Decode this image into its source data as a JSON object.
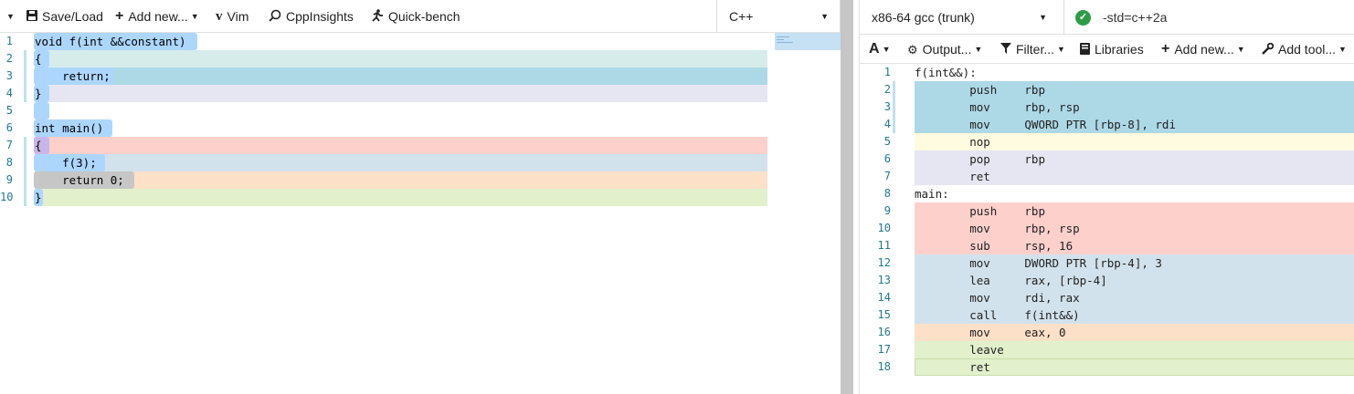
{
  "editor_toolbar": {
    "save_load": "Save/Load",
    "add_new": "Add new...",
    "vim": "Vim",
    "cppinsights": "CppInsights",
    "quick_bench": "Quick-bench",
    "language": "C++"
  },
  "source_lines": [
    {
      "n": "1",
      "text": "void f(int &&constant)"
    },
    {
      "n": "2",
      "text": "{"
    },
    {
      "n": "3",
      "text": "    return;"
    },
    {
      "n": "4",
      "text": "}"
    },
    {
      "n": "5",
      "text": ""
    },
    {
      "n": "6",
      "text": "int main()"
    },
    {
      "n": "7",
      "text": "{"
    },
    {
      "n": "8",
      "text": "    f(3);"
    },
    {
      "n": "9",
      "text": "    return 0;"
    },
    {
      "n": "10",
      "text": "}"
    }
  ],
  "compiler_bar": {
    "compiler": "x86-64 gcc (trunk)",
    "options": "-std=c++2a"
  },
  "output_toolbar": {
    "font": "A",
    "output": "Output...",
    "filter": "Filter...",
    "libraries": "Libraries",
    "add_new": "Add new...",
    "add_tool": "Add tool..."
  },
  "asm_lines": [
    {
      "n": "1",
      "text": "f(int&&):"
    },
    {
      "n": "2",
      "text": "        push    rbp"
    },
    {
      "n": "3",
      "text": "        mov     rbp, rsp"
    },
    {
      "n": "4",
      "text": "        mov     QWORD PTR [rbp-8], rdi"
    },
    {
      "n": "5",
      "text": "        nop"
    },
    {
      "n": "6",
      "text": "        pop     rbp"
    },
    {
      "n": "7",
      "text": "        ret"
    },
    {
      "n": "8",
      "text": "main:"
    },
    {
      "n": "9",
      "text": "        push    rbp"
    },
    {
      "n": "10",
      "text": "        mov     rbp, rsp"
    },
    {
      "n": "11",
      "text": "        sub     rsp, 16"
    },
    {
      "n": "12",
      "text": "        mov     DWORD PTR [rbp-4], 3"
    },
    {
      "n": "13",
      "text": "        lea     rax, [rbp-4]"
    },
    {
      "n": "14",
      "text": "        mov     rdi, rax"
    },
    {
      "n": "15",
      "text": "        call    f(int&&)"
    },
    {
      "n": "16",
      "text": "        mov     eax, 0"
    },
    {
      "n": "17",
      "text": "        leave"
    },
    {
      "n": "18",
      "text": "        ret"
    }
  ],
  "colors": {
    "line_blue": "#add8e6",
    "line_teal": "#d6ecea",
    "line_lavender": "#e6e6f2",
    "line_pink": "#fdd0cc",
    "line_steel": "#d2e2ec",
    "line_peach": "#fde0c8",
    "line_green": "#e2f0cc",
    "line_cream": "#fffbe0",
    "selection": "#add6ff",
    "status_ok": "#2e9c46"
  }
}
